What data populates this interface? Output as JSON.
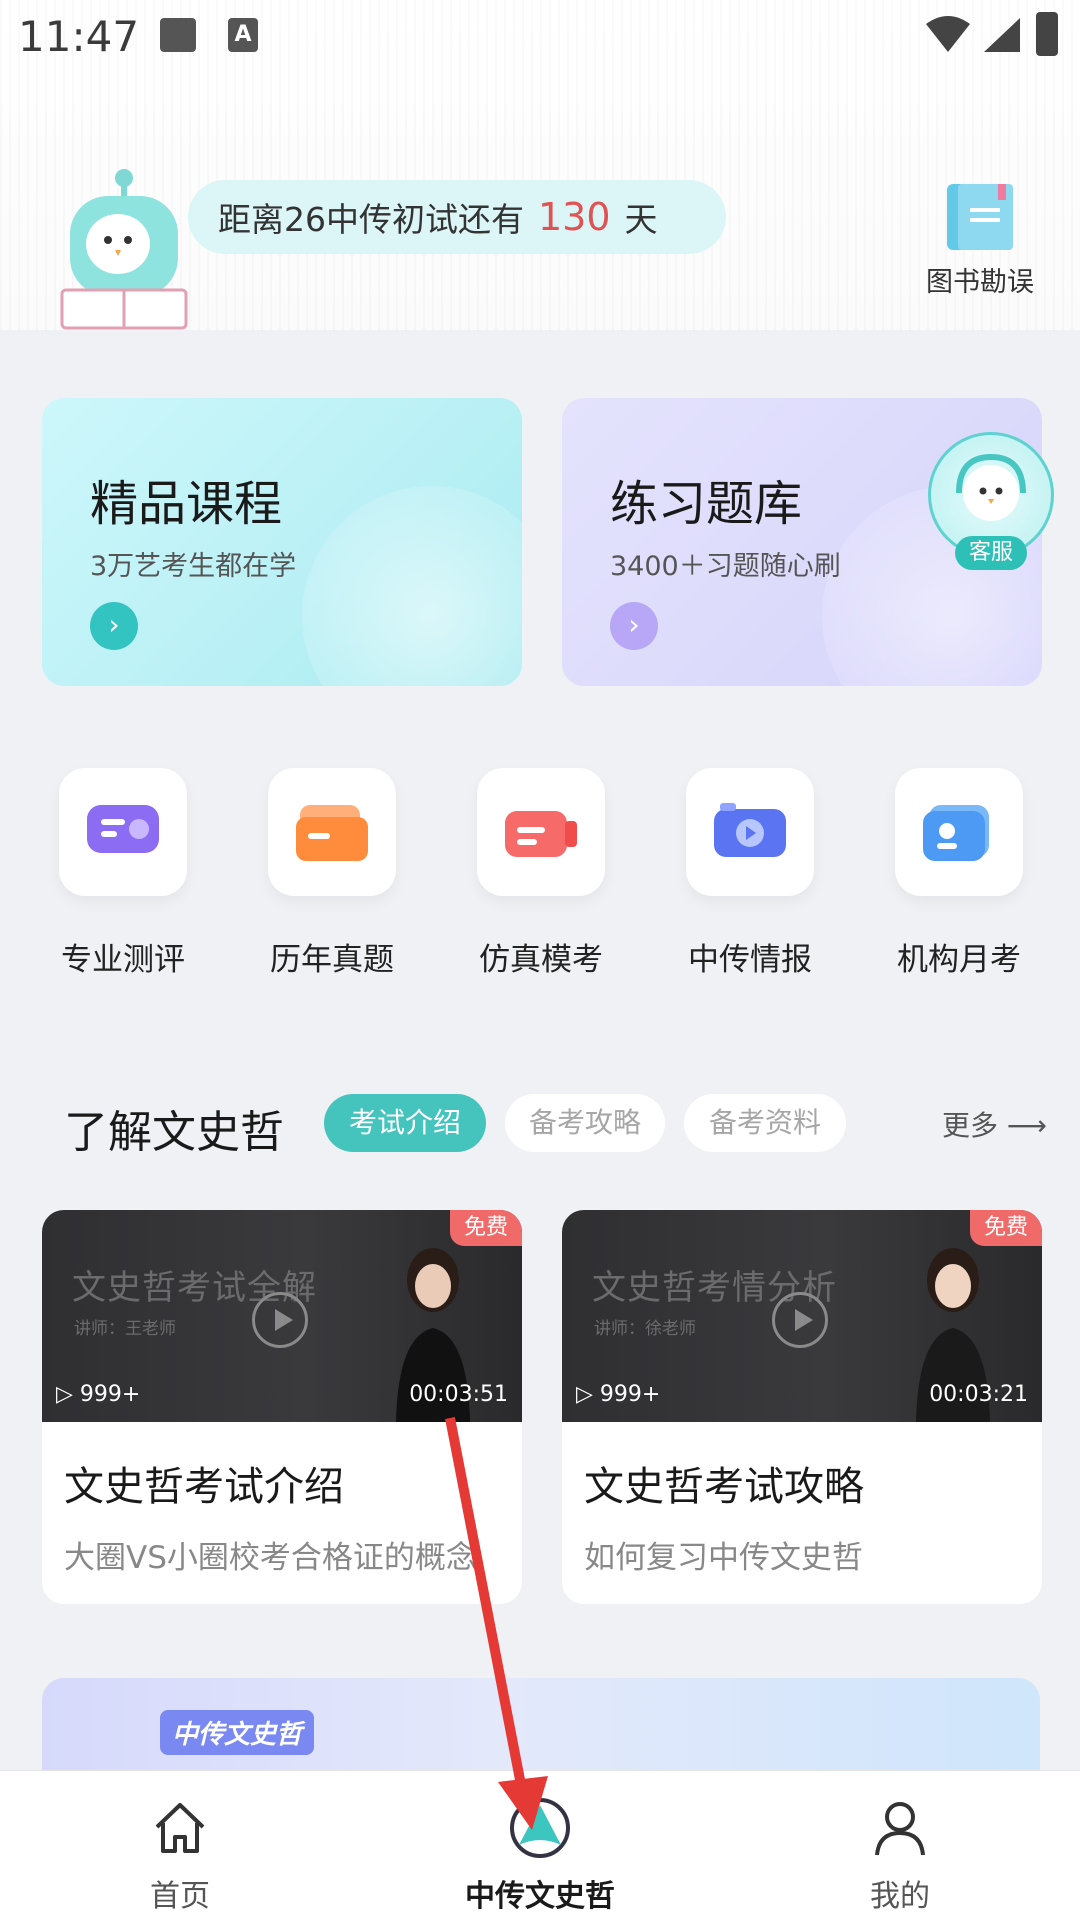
{
  "status_bar": {
    "time": "11:47"
  },
  "header": {
    "countdown_prefix": "距离26中传初试还有",
    "countdown_days": "130",
    "countdown_suffix": "天",
    "errata_label": "图书勘误"
  },
  "cards": [
    {
      "title": "精品课程",
      "subtitle": "3万艺考生都在学",
      "arrow": "›"
    },
    {
      "title": "练习题库",
      "subtitle": "3400＋习题随心刷",
      "arrow": "›"
    }
  ],
  "service": {
    "badge": "客服"
  },
  "entries": [
    {
      "label": "专业测评",
      "icon": "assessment-icon",
      "color": "#8b6cf3"
    },
    {
      "label": "历年真题",
      "icon": "folder-icon",
      "color": "#ff8b3d"
    },
    {
      "label": "仿真模考",
      "icon": "mock-exam-icon",
      "color": "#f66a6a"
    },
    {
      "label": "中传情报",
      "icon": "camera-icon",
      "color": "#5a74f2"
    },
    {
      "label": "机构月考",
      "icon": "contact-card-icon",
      "color": "#4d9af5"
    }
  ],
  "section": {
    "title": "了解文史哲",
    "tabs": [
      "考试介绍",
      "备考攻略",
      "备考资料"
    ],
    "more": "更多"
  },
  "videos": [
    {
      "thumb_title": "文史哲考试全解",
      "lecturer": "讲师：王老师",
      "free": "免费",
      "views": "999+",
      "duration": "00:03:51",
      "title": "文史哲考试介绍",
      "subtitle": "大圈VS小圈校考合格证的概念"
    },
    {
      "thumb_title": "文史哲考情分析",
      "lecturer": "讲师：徐老师",
      "free": "免费",
      "views": "999+",
      "duration": "00:03:21",
      "title": "文史哲考试攻略",
      "subtitle": "如何复习中传文史哲"
    }
  ],
  "banner": {
    "label": "中传文史哲"
  },
  "tabbar": [
    {
      "label": "首页",
      "icon": "home-icon"
    },
    {
      "label": "中传文史哲",
      "icon": "app-logo-icon"
    },
    {
      "label": "我的",
      "icon": "user-icon"
    }
  ],
  "colors": {
    "accent": "#45c3bd",
    "annotation": "#e53935"
  }
}
